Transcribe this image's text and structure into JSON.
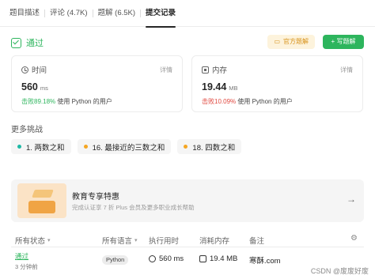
{
  "tabs": [
    "题目描述",
    "评论 (4.7K)",
    "题解 (6.5K)",
    "提交记录"
  ],
  "active_tab": 3,
  "status": {
    "label": "通过",
    "official_label": "官方题解",
    "write_label": "写题解",
    "write_plus": "+"
  },
  "time_card": {
    "title": "时间",
    "detail": "详情",
    "value": "560",
    "unit": "ms",
    "beat_prefix": "击败",
    "beat_pct": "89.18%",
    "beat_suffix": "使用 Python 的用户"
  },
  "memory_card": {
    "title": "内存",
    "detail": "详情",
    "value": "19.44",
    "unit": "MB",
    "beat_prefix": "击败",
    "beat_pct": "10.09%",
    "beat_suffix": "使用 Python 的用户"
  },
  "more": {
    "title": "更多挑战",
    "items": [
      {
        "label": "1. 两数之和",
        "color": "#1eb9a5"
      },
      {
        "label": "16. 最接近的三数之和",
        "color": "#f5a623"
      },
      {
        "label": "18. 四数之和",
        "color": "#f5a623"
      }
    ]
  },
  "promo": {
    "title": "教育专享特惠",
    "subtitle": "完成认证享 7 折 Plus 会员及更多职业成长帮助",
    "arrow": "→"
  },
  "table": {
    "headers": {
      "status": "所有状态",
      "language": "所有语言",
      "runtime": "执行用时",
      "memory": "消耗内存",
      "note": "备注"
    },
    "row": {
      "status": "通过",
      "time_ago": "3 分钟前",
      "language": "Python",
      "runtime": "560 ms",
      "memory": "19.4 MB",
      "note": "寒酥.com"
    }
  },
  "watermark": "CSDN @废废好废"
}
